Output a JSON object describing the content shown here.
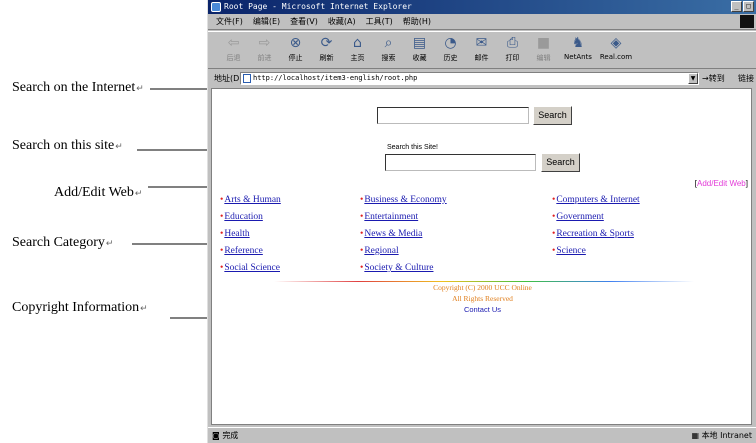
{
  "annotations": [
    {
      "label": "Search on the Internet",
      "mark": "↵"
    },
    {
      "label": "Search on this site",
      "mark": "↵"
    },
    {
      "label": "Add/Edit Web",
      "mark": "↵"
    },
    {
      "label": "Search Category",
      "mark": "↵"
    },
    {
      "label": "Copyright Information",
      "mark": "↵"
    }
  ],
  "browser": {
    "title": "Root Page - Microsoft Internet Explorer",
    "menu": [
      "文件(F)",
      "编辑(E)",
      "查看(V)",
      "收藏(A)",
      "工具(T)",
      "帮助(H)"
    ],
    "toolbar": [
      {
        "label": "后退",
        "icon": "back-arrow-icon"
      },
      {
        "label": "前进",
        "icon": "forward-arrow-icon"
      },
      {
        "label": "停止",
        "icon": "stop-icon"
      },
      {
        "label": "刷新",
        "icon": "refresh-icon"
      },
      {
        "label": "主页",
        "icon": "home-icon"
      },
      {
        "label": "搜索",
        "icon": "search-icon"
      },
      {
        "label": "收藏",
        "icon": "favorites-icon"
      },
      {
        "label": "历史",
        "icon": "history-icon"
      },
      {
        "label": "邮件",
        "icon": "mail-icon"
      },
      {
        "label": "打印",
        "icon": "print-icon"
      },
      {
        "label": "编辑",
        "icon": "edit-icon"
      },
      {
        "label": "NetAnts",
        "icon": "netants-icon"
      },
      {
        "label": "Real.com",
        "icon": "real-icon"
      }
    ],
    "address_label": "地址(D)",
    "address_url": "http://localhost/item3-english/root.php",
    "go_label": "转到",
    "links_label": "链接",
    "status_left": "完成",
    "status_right": "本地 Intranet"
  },
  "page": {
    "search_top_button": "Search",
    "site_label": "Search this Site!",
    "search_site_button": "Search",
    "add_edit_link": "Add/Edit Web",
    "categories": [
      [
        "Arts & Human",
        "Business & Economy",
        "Computers & Internet"
      ],
      [
        "Education",
        "Entertainment",
        "Government"
      ],
      [
        "Health",
        "News & Media",
        "Recreation & Sports"
      ],
      [
        "Reference",
        "Regional",
        "Science"
      ],
      [
        "Social Science",
        "Society & Culture",
        ""
      ]
    ],
    "copyright": "Copyright (C) 2000 UCC Online",
    "rights": "All Rights Reserved",
    "contact": "Contact Us"
  }
}
